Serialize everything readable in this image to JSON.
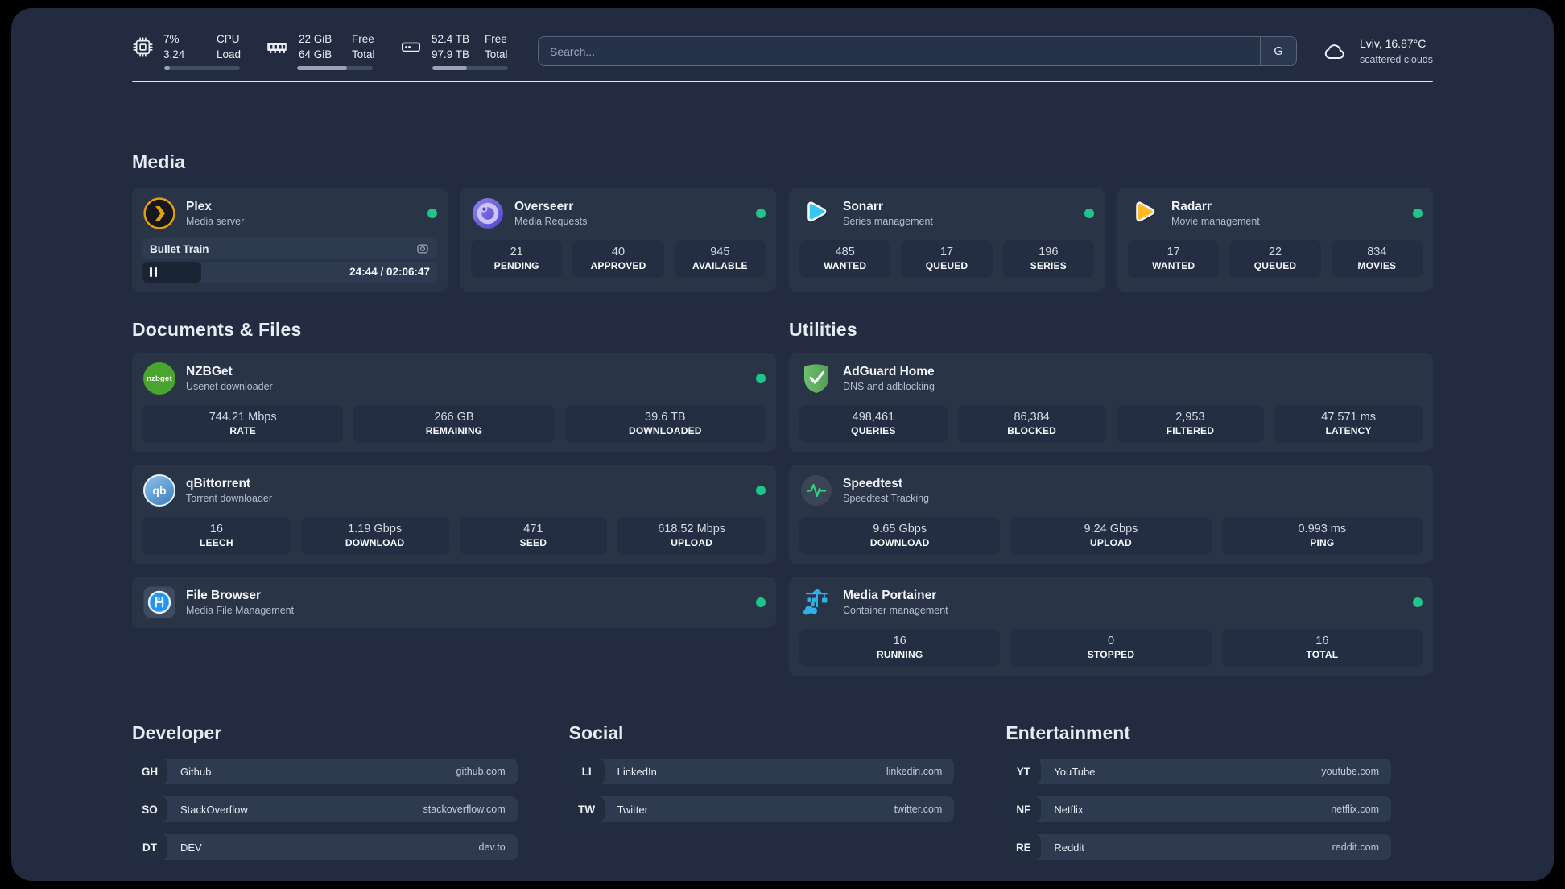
{
  "colors": {
    "background": "#222B40",
    "card": "#2A3447",
    "stat_tile": "#242E42",
    "status_online": "#21C58C",
    "plex_amber": "#E5A00D",
    "sonarr_blue": "#36C6F4",
    "radarr_yellow": "#FFB923",
    "nzbget_green": "#4AA42D",
    "adguard_green": "#63B862",
    "speedtest_pulse": "#2FD07E",
    "portainer_blue": "#2FB0E8"
  },
  "header": {
    "system_stats": [
      {
        "id": "cpu",
        "icon": "cpu-chip-icon",
        "values": [
          "7%",
          "3.24"
        ],
        "labels": [
          "CPU",
          "Load"
        ],
        "progress_pct": 7
      },
      {
        "id": "memory",
        "icon": "ram-icon",
        "values": [
          "22 GiB",
          "64 GiB"
        ],
        "labels": [
          "Free",
          "Total"
        ],
        "progress_pct": 66
      },
      {
        "id": "disk",
        "icon": "hard-drive-icon",
        "values": [
          "52.4 TB",
          "97.9 TB"
        ],
        "labels": [
          "Free",
          "Total"
        ],
        "progress_pct": 46
      }
    ],
    "search": {
      "placeholder": "Search...",
      "engine_label": "G"
    },
    "weather": {
      "location_temp": "Lviv, 16.87°C",
      "condition": "scattered clouds"
    }
  },
  "sections": {
    "media": {
      "title": "Media",
      "apps": [
        {
          "name": "Plex",
          "description": "Media server",
          "icon": "plex-icon",
          "online": true,
          "player": {
            "title": "Bullet Train",
            "time": "24:44 / 02:06:47",
            "progress_pct": 20
          }
        },
        {
          "name": "Overseerr",
          "description": "Media Requests",
          "icon": "overseerr-icon",
          "online": true,
          "stats": [
            {
              "value": "21",
              "label": "PENDING"
            },
            {
              "value": "40",
              "label": "APPROVED"
            },
            {
              "value": "945",
              "label": "AVAILABLE"
            }
          ]
        },
        {
          "name": "Sonarr",
          "description": "Series management",
          "icon": "sonarr-icon",
          "online": true,
          "stats": [
            {
              "value": "485",
              "label": "WANTED"
            },
            {
              "value": "17",
              "label": "QUEUED"
            },
            {
              "value": "196",
              "label": "SERIES"
            }
          ]
        },
        {
          "name": "Radarr",
          "description": "Movie management",
          "icon": "radarr-icon",
          "online": true,
          "stats": [
            {
              "value": "17",
              "label": "WANTED"
            },
            {
              "value": "22",
              "label": "QUEUED"
            },
            {
              "value": "834",
              "label": "MOVIES"
            }
          ]
        }
      ]
    },
    "documents": {
      "title": "Documents & Files",
      "apps": [
        {
          "name": "NZBGet",
          "description": "Usenet downloader",
          "icon": "nzbget-icon",
          "icon_text": "nzbget",
          "online": true,
          "stats": [
            {
              "value": "744.21 Mbps",
              "label": "RATE"
            },
            {
              "value": "266 GB",
              "label": "REMAINING"
            },
            {
              "value": "39.6 TB",
              "label": "DOWNLOADED"
            }
          ]
        },
        {
          "name": "qBittorrent",
          "description": "Torrent downloader",
          "icon": "qbittorrent-icon",
          "icon_text": "qb",
          "online": true,
          "stats": [
            {
              "value": "16",
              "label": "LEECH"
            },
            {
              "value": "1.19 Gbps",
              "label": "DOWNLOAD"
            },
            {
              "value": "471",
              "label": "SEED"
            },
            {
              "value": "618.52 Mbps",
              "label": "UPLOAD"
            }
          ]
        },
        {
          "name": "File Browser",
          "description": "Media File Management",
          "icon": "filebrowser-icon",
          "online": true,
          "stats": []
        }
      ]
    },
    "utilities": {
      "title": "Utilities",
      "apps": [
        {
          "name": "AdGuard Home",
          "description": "DNS and adblocking",
          "icon": "adguard-icon",
          "online": false,
          "stats": [
            {
              "value": "498,461",
              "label": "QUERIES"
            },
            {
              "value": "86,384",
              "label": "BLOCKED"
            },
            {
              "value": "2,953",
              "label": "FILTERED"
            },
            {
              "value": "47.571 ms",
              "label": "LATENCY"
            }
          ]
        },
        {
          "name": "Speedtest",
          "description": "Speedtest Tracking",
          "icon": "speedtest-icon",
          "online": false,
          "stats": [
            {
              "value": "9.65 Gbps",
              "label": "DOWNLOAD"
            },
            {
              "value": "9.24 Gbps",
              "label": "UPLOAD"
            },
            {
              "value": "0.993 ms",
              "label": "PING"
            }
          ]
        },
        {
          "name": "Media Portainer",
          "description": "Container management",
          "icon": "portainer-icon",
          "online": true,
          "stats": [
            {
              "value": "16",
              "label": "RUNNING"
            },
            {
              "value": "0",
              "label": "STOPPED"
            },
            {
              "value": "16",
              "label": "TOTAL"
            }
          ]
        }
      ]
    }
  },
  "link_groups": [
    {
      "title": "Developer",
      "links": [
        {
          "tag": "GH",
          "name": "Github",
          "url": "github.com"
        },
        {
          "tag": "SO",
          "name": "StackOverflow",
          "url": "stackoverflow.com"
        },
        {
          "tag": "DT",
          "name": "DEV",
          "url": "dev.to"
        }
      ]
    },
    {
      "title": "Social",
      "links": [
        {
          "tag": "LI",
          "name": "LinkedIn",
          "url": "linkedin.com"
        },
        {
          "tag": "TW",
          "name": "Twitter",
          "url": "twitter.com"
        }
      ]
    },
    {
      "title": "Entertainment",
      "links": [
        {
          "tag": "YT",
          "name": "YouTube",
          "url": "youtube.com"
        },
        {
          "tag": "NF",
          "name": "Netflix",
          "url": "netflix.com"
        },
        {
          "tag": "RE",
          "name": "Reddit",
          "url": "reddit.com"
        }
      ]
    }
  ]
}
